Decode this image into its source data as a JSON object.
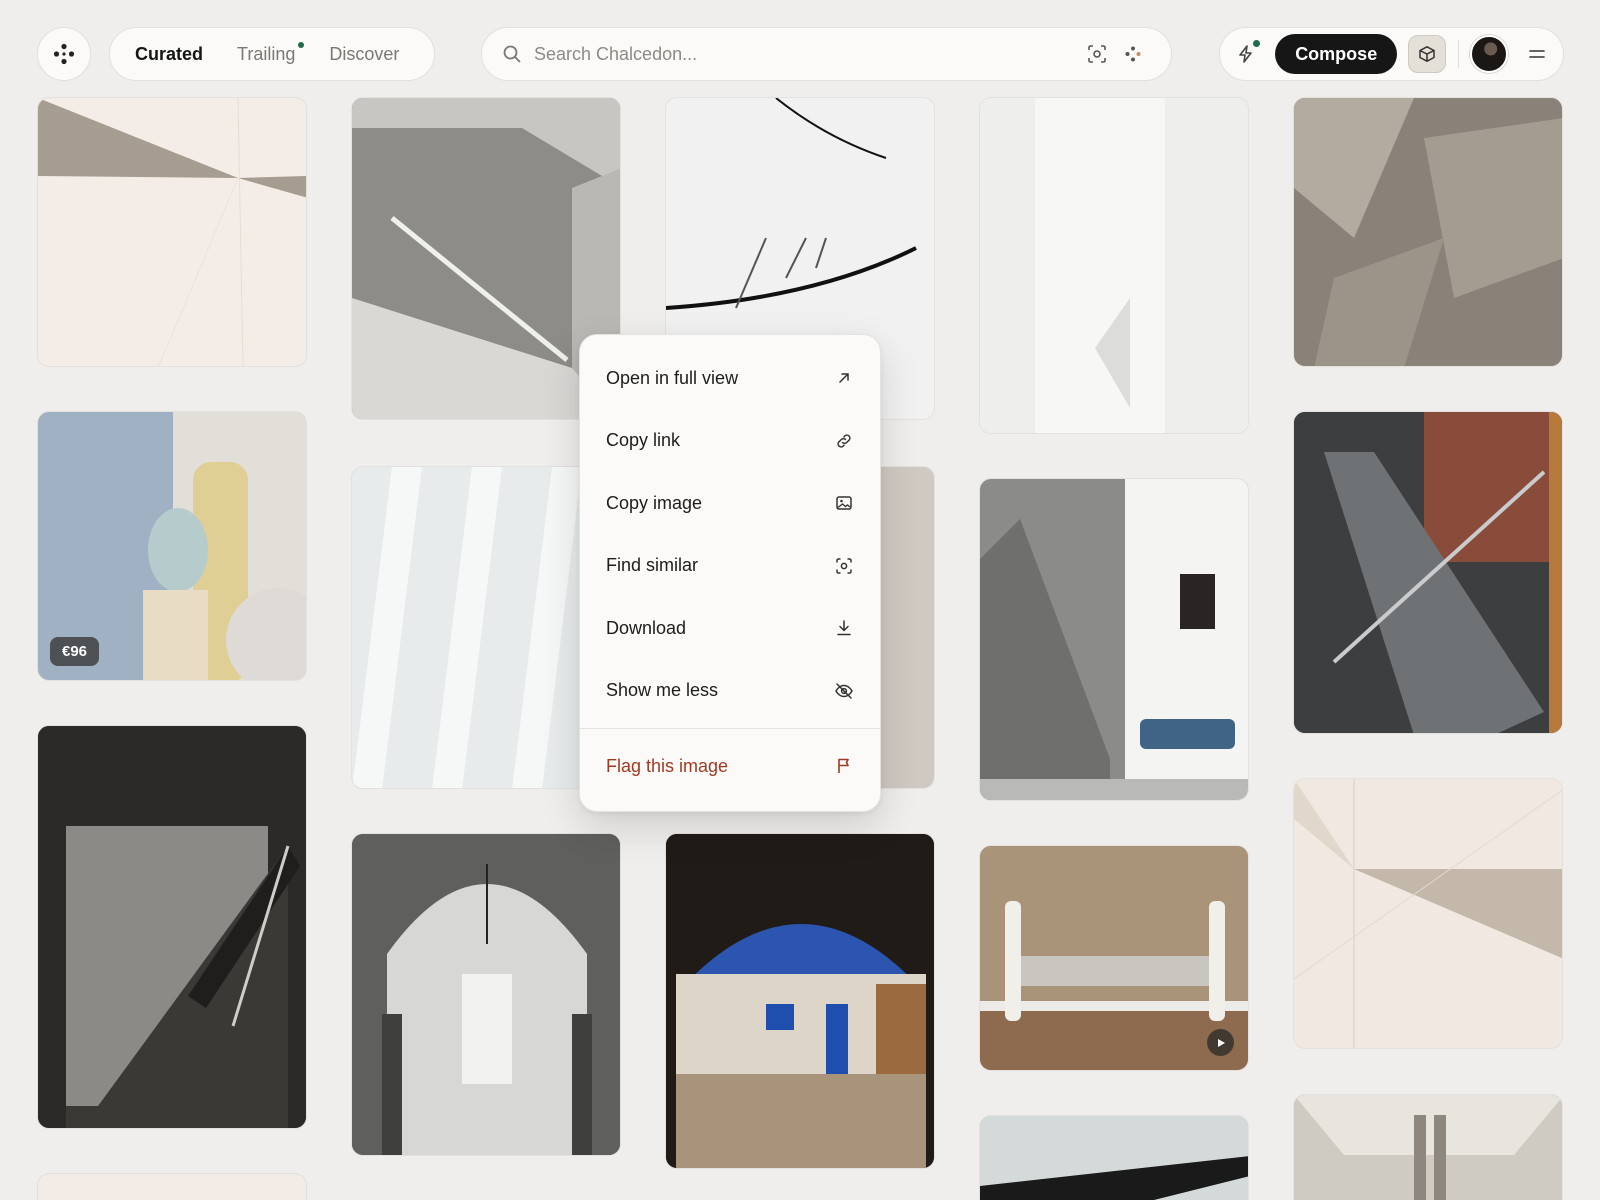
{
  "header": {
    "tabs": [
      {
        "label": "Curated",
        "active": true
      },
      {
        "label": "Trailing",
        "active": false,
        "has_dot": true
      },
      {
        "label": "Discover",
        "active": false
      }
    ],
    "search": {
      "placeholder": "Search Chalcedon..."
    },
    "compose_label": "Compose"
  },
  "grid": {
    "price_badge": "€96"
  },
  "context_menu": {
    "items": [
      {
        "label": "Open in full view",
        "icon": "arrow-up-right-icon"
      },
      {
        "label": "Copy link",
        "icon": "link-icon"
      },
      {
        "label": "Copy image",
        "icon": "image-icon"
      },
      {
        "label": "Find similar",
        "icon": "scan-icon"
      },
      {
        "label": "Download",
        "icon": "download-icon"
      },
      {
        "label": "Show me less",
        "icon": "eye-off-icon"
      }
    ],
    "danger_item": {
      "label": "Flag this image",
      "icon": "flag-icon"
    }
  },
  "colors": {
    "background": "#efeeec",
    "accent_dot": "#1f6b4a",
    "danger": "#a13a22",
    "compose_bg": "#161616"
  }
}
